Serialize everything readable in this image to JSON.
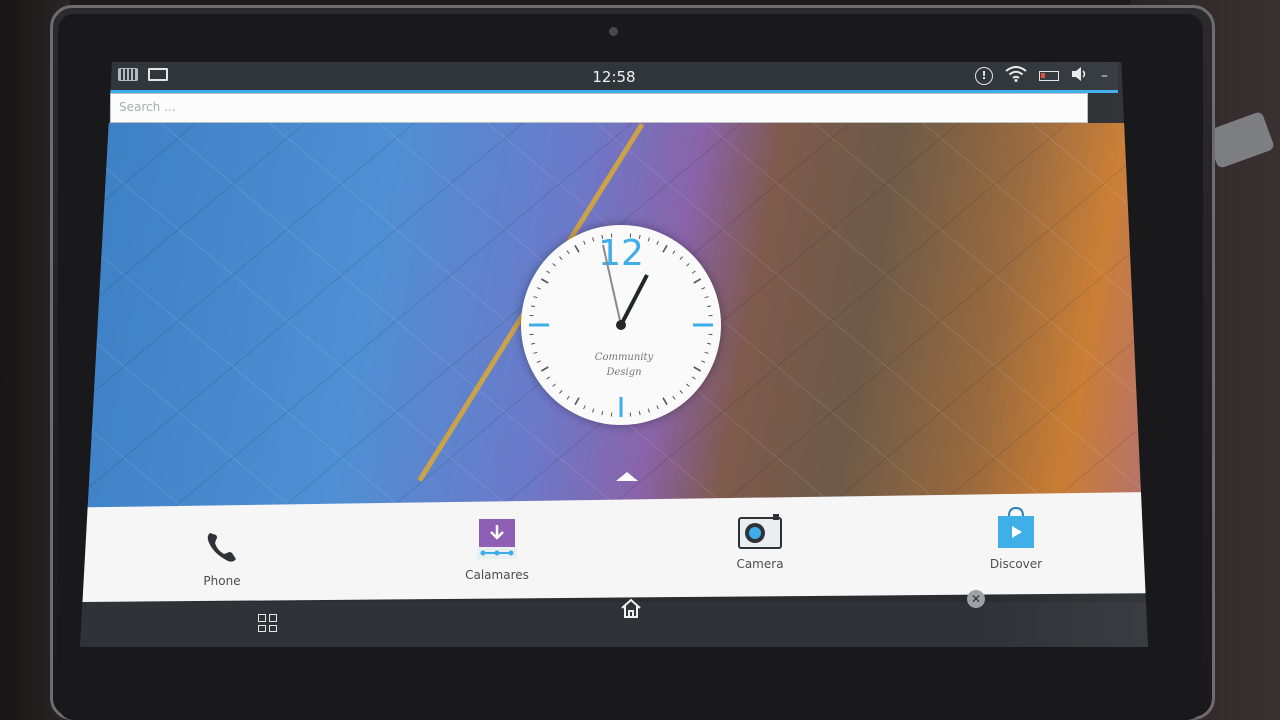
{
  "statusbar": {
    "time": "12:58",
    "left_icons": [
      "keyboard-icon",
      "monitor-icon"
    ],
    "right_icons": [
      "notification-icon",
      "wifi-icon",
      "battery-icon",
      "volume-icon",
      "menu-icon"
    ]
  },
  "search": {
    "placeholder": "Search ..."
  },
  "clock": {
    "hour_label": "12",
    "caption_line1": "Community",
    "caption_line2": "Design",
    "accent": "#3daee9"
  },
  "dock": {
    "apps": [
      {
        "label": "Phone",
        "icon": "phone-icon"
      },
      {
        "label": "Calamares",
        "icon": "calamares-icon"
      },
      {
        "label": "Camera",
        "icon": "camera-icon"
      },
      {
        "label": "Discover",
        "icon": "discover-icon"
      }
    ]
  },
  "navbar": {
    "buttons": [
      "app-grid-icon",
      "home-icon",
      "close-icon"
    ]
  },
  "colors": {
    "accent": "#3daee9",
    "statusbar": "#31363b",
    "dock": "#f6f6f6",
    "navbar": "#2f3337"
  }
}
